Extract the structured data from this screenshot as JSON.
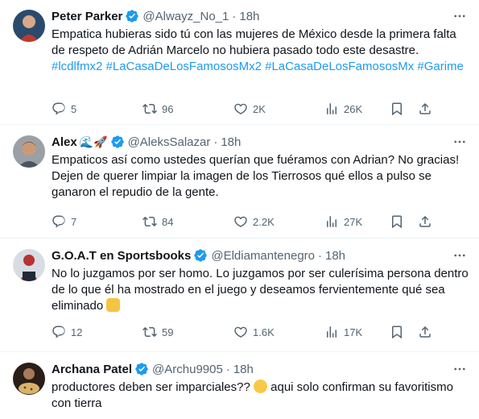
{
  "colors": {
    "accent": "#1d9bf0",
    "verified": "#1d9bf0",
    "muted": "#536471",
    "divider": "#eff3f4"
  },
  "tweets": [
    {
      "name": "Peter Parker",
      "handle": "@Alwayz_No_1",
      "time": "18h",
      "text": "Empatica hubieras sido tú con las mujeres de México desde la primera falta de respeto de Adrián Marcelo no hubiera pasado todo este desastre.",
      "hashtags": "#lcdlfmx2 #LaCasaDeLosFamososMx2 #LaCasaDeLosFamososMx #Garime",
      "replies": "5",
      "reposts": "96",
      "likes": "2K",
      "views": "26K"
    },
    {
      "name": "Alex",
      "name_emojis": "🌊🚀",
      "handle": "@AleksSalazar",
      "time": "18h",
      "text": "Empaticos así como ustedes querían que fuéramos con Adrian? No gracias! Dejen de querer limpiar la imagen de los Tierrosos qué ellos a pulso se ganaron el repudio de la gente.",
      "replies": "7",
      "reposts": "84",
      "likes": "2.2K",
      "views": "27K"
    },
    {
      "name": "G.O.A.T en Sportsbooks",
      "handle": "@Eldiamantenegro",
      "time": "18h",
      "text": "No lo juzgamos por ser homo. Lo juzgamos por ser culerísima persona dentro de lo que él ha mostrado en el juego y deseamos fervientemente qué sea eliminado",
      "replies": "12",
      "reposts": "59",
      "likes": "1.6K",
      "views": "17K"
    },
    {
      "name": "Archana Patel",
      "handle": "@Archu9905",
      "time": "18h",
      "text_a": "productores deben ser imparciales??",
      "text_b": "aqui solo confirman su favoritismo con tierra"
    }
  ]
}
